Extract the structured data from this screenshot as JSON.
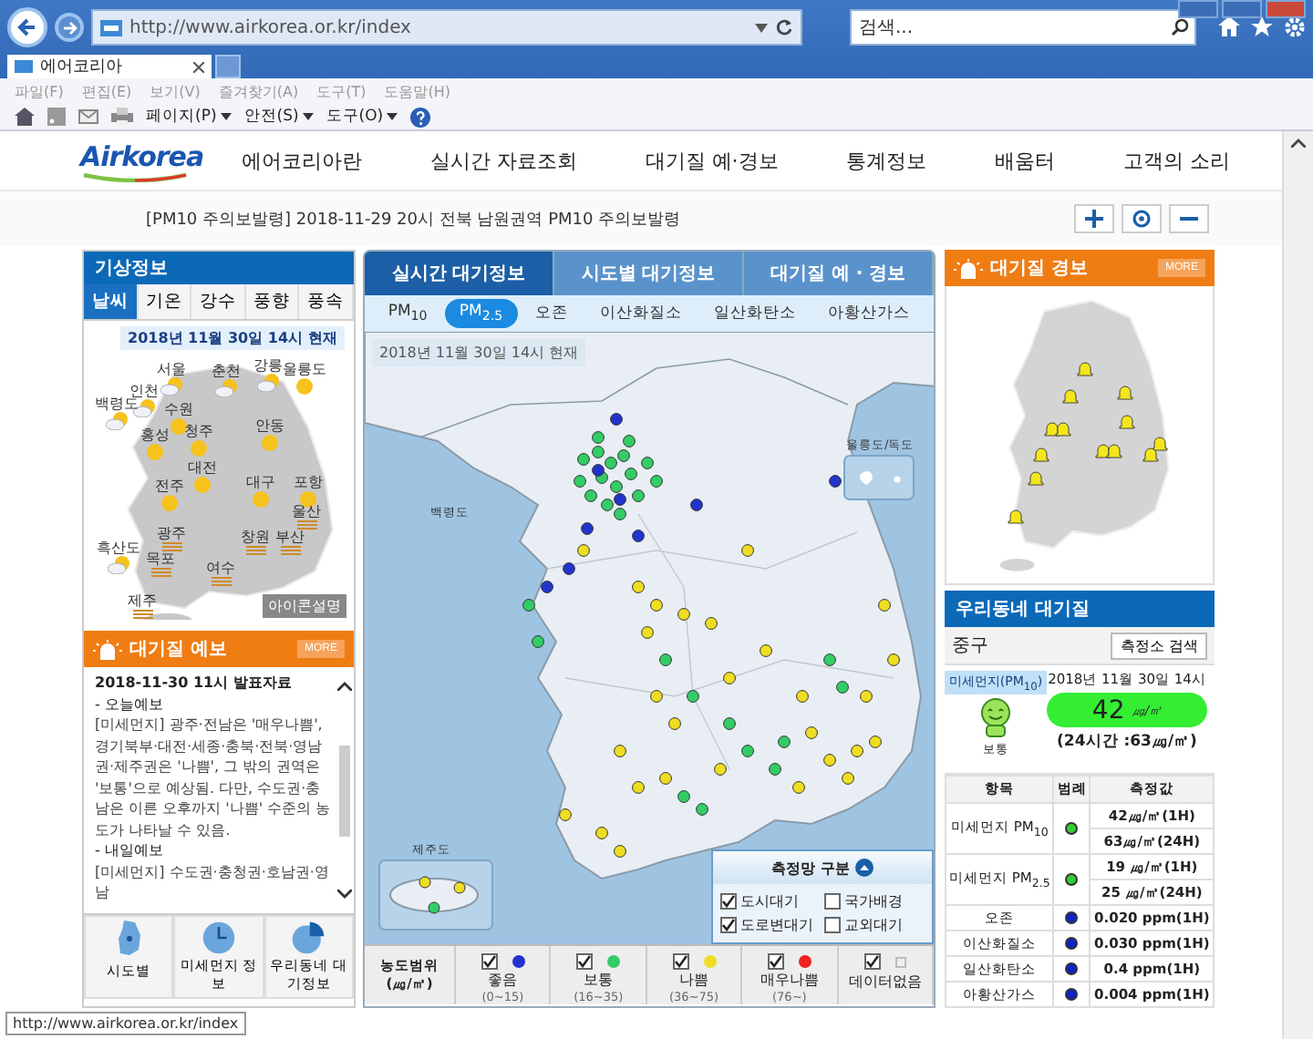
{
  "browser": {
    "url": "http://www.airkorea.or.kr/index",
    "search_placeholder": "검색...",
    "tab_title": "에어코리아",
    "menu": [
      "파일(F)",
      "편집(E)",
      "보기(V)",
      "즐겨찾기(A)",
      "도구(T)",
      "도움말(H)"
    ],
    "commands": [
      "페이지(P)",
      "안전(S)",
      "도구(O)"
    ],
    "status_url": "http://www.airkorea.or.kr/index"
  },
  "header": {
    "logo": "Airkorea",
    "nav": [
      "에어코리아란",
      "실시간 자료조회",
      "대기질 예·경보",
      "통계정보",
      "배움터",
      "고객의 소리"
    ]
  },
  "notice": "[PM10 주의보발령] 2018-11-29 20시 전북 남원권역 PM10 주의보발령",
  "weather": {
    "title": "기상정보",
    "tabs": [
      {
        "label": "날씨",
        "selected": true
      },
      {
        "label": "기온",
        "selected": false
      },
      {
        "label": "강수",
        "selected": false
      },
      {
        "label": "풍향",
        "selected": false
      },
      {
        "label": "풍속",
        "selected": false
      }
    ],
    "timestamp": "2018년 11월 30일 14시 현재",
    "cities": [
      {
        "name": "서울",
        "kind": "partly_cloudy"
      },
      {
        "name": "춘천",
        "kind": "partly_cloudy"
      },
      {
        "name": "강릉",
        "kind": "partly_cloudy"
      },
      {
        "name": "울릉도",
        "kind": "sunny"
      },
      {
        "name": "인천",
        "kind": "partly_cloudy"
      },
      {
        "name": "백령도",
        "kind": "partly_cloudy"
      },
      {
        "name": "수원",
        "kind": "sunny"
      },
      {
        "name": "홍성",
        "kind": "sunny"
      },
      {
        "name": "청주",
        "kind": "sunny"
      },
      {
        "name": "안동",
        "kind": "sunny"
      },
      {
        "name": "대전",
        "kind": "sunny"
      },
      {
        "name": "전주",
        "kind": "sunny"
      },
      {
        "name": "대구",
        "kind": "sunny"
      },
      {
        "name": "포항",
        "kind": "sunny"
      },
      {
        "name": "울산",
        "kind": "haze"
      },
      {
        "name": "광주",
        "kind": "haze"
      },
      {
        "name": "창원",
        "kind": "haze"
      },
      {
        "name": "부산",
        "kind": "haze"
      },
      {
        "name": "흑산도",
        "kind": "partly_cloudy"
      },
      {
        "name": "목포",
        "kind": "haze"
      },
      {
        "name": "여수",
        "kind": "haze"
      },
      {
        "name": "제주",
        "kind": "haze"
      }
    ],
    "legend_button": "아이콘설명"
  },
  "forecast": {
    "title": "대기질 예보",
    "more": "MORE",
    "issued": "2018-11-30 11시 발표자료",
    "items": [
      {
        "kind": "heading",
        "text": "- 오늘예보"
      },
      {
        "kind": "bullet",
        "text": "[미세먼지] 광주·전남은 '매우나쁨', 경기북부·대전·세종·충북·전북·영남권·제주권은 '나쁨', 그 밖의 권역은 '보통'으로 예상됨. 다만, 수도권·충남은 이른 오후까지 '나쁨' 수준의 농도가 나타날 수 있음."
      },
      {
        "kind": "heading",
        "text": "- 내일예보"
      },
      {
        "kind": "bullet",
        "text": "[미세먼지] 수도권·충청권·호남권·영남"
      }
    ]
  },
  "quick_links": [
    {
      "label": "시도별",
      "kind": "map"
    },
    {
      "label": "미세먼지 정보",
      "kind": "clock"
    },
    {
      "label": "우리동네 대기정보",
      "kind": "pie"
    }
  ],
  "center": {
    "tabs": [
      {
        "label": "실시간 대기정보",
        "selected": true
      },
      {
        "label": "시도별 대기정보",
        "selected": false
      },
      {
        "label": "대기질 예 · 경보",
        "selected": false
      }
    ],
    "pollutants": [
      {
        "label": "PM$_{10}$",
        "selected": false
      },
      {
        "label": "PM$_{2.5}$",
        "selected": true
      },
      {
        "label": "오존",
        "selected": false
      },
      {
        "label": "이산화질소",
        "selected": false
      },
      {
        "label": "일산화탄소",
        "selected": false
      },
      {
        "label": "아황산가스",
        "selected": false
      }
    ],
    "timestamp": "2018년 11월 30일 14시 현재",
    "map_labels": [
      "울릉도/독도",
      "백령도",
      "제주도"
    ],
    "network": {
      "title": "측정망 구분",
      "options": [
        {
          "label": "도시대기",
          "checked": true
        },
        {
          "label": "국가배경",
          "checked": false
        },
        {
          "label": "도로변대기",
          "checked": true
        },
        {
          "label": "교외대기",
          "checked": false
        }
      ]
    },
    "range": {
      "title": "농도범위",
      "unit": "(㎍/㎥)",
      "levels": [
        {
          "label": "좋음",
          "range": "(0~15)",
          "kind": "dot",
          "color": "#2233cc",
          "checked": true
        },
        {
          "label": "보통",
          "range": "(16~35)",
          "kind": "dot",
          "color": "#33cc66",
          "checked": true
        },
        {
          "label": "나쁨",
          "range": "(36~75)",
          "kind": "dot",
          "color": "#eedd22",
          "checked": true
        },
        {
          "label": "매우나쁨",
          "range": "(76~)",
          "kind": "dot",
          "color": "#ee2222",
          "checked": true
        },
        {
          "label": "데이터없음",
          "kind": "nodata",
          "checked": true
        }
      ]
    }
  },
  "alert": {
    "title": "대기질 경보",
    "more": "MORE"
  },
  "neighborhood": {
    "title": "우리동네 대기질",
    "district": "중구",
    "search_button": "측정소 검색",
    "badge": "미세먼지(PM$_{10}$)",
    "time": "2018년 11월 30일 14시",
    "value": "42",
    "unit": "㎍/㎥",
    "average": "(24시간 :63㎍/㎥)",
    "grade": "보통",
    "columns": [
      "항목",
      "범례",
      "측정값"
    ],
    "rows": [
      {
        "item": "미세먼지 PM$_{10}$",
        "color": "#33cc33",
        "values": [
          "42㎍/㎥(1H)",
          "63㎍/㎥(24H)"
        ]
      },
      {
        "item": "미세먼지 PM$_{2.5}$",
        "color": "#33cc33",
        "values": [
          "19 ㎍/㎥(1H)",
          "25 ㎍/㎥(24H)"
        ]
      },
      {
        "item": "오존",
        "color": "#1122cc",
        "values": [
          "0.020 ppm(1H)"
        ]
      },
      {
        "item": "이산화질소",
        "color": "#1122cc",
        "values": [
          "0.030 ppm(1H)"
        ]
      },
      {
        "item": "일산화탄소",
        "color": "#1122cc",
        "values": [
          "0.4 ppm(1H)"
        ]
      },
      {
        "item": "아황산가스",
        "color": "#1122cc",
        "values": [
          "0.004 ppm(1H)"
        ]
      }
    ]
  }
}
